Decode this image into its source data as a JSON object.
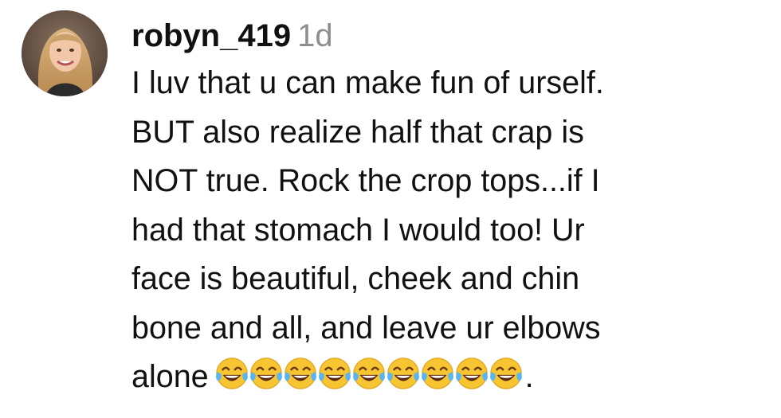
{
  "comment": {
    "username": "robyn_419",
    "timestamp": "1d",
    "lines": [
      "I luv that u can make fun of urself.",
      "BUT also realize half that crap is",
      "NOT true. Rock the crop tops...if I",
      "had that stomach I would too! Ur",
      "face is beautiful, cheek and chin",
      "bone and all, and leave ur elbows",
      "alone"
    ],
    "trailing_emoji": "face-with-tears-of-joy",
    "trailing_emoji_count": 9,
    "trailing_punctuation": "."
  }
}
